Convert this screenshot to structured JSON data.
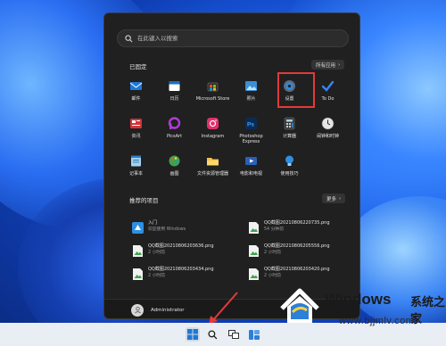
{
  "search": {
    "placeholder": "在此键入以搜索"
  },
  "pinned": {
    "title": "已固定",
    "all_apps": "所有应用",
    "apps": [
      {
        "label": "邮件",
        "icon": "mail-icon",
        "color": "#1e78d7"
      },
      {
        "label": "日历",
        "icon": "calendar-icon",
        "color": "#1d6fc4"
      },
      {
        "label": "Microsoft Store",
        "icon": "store-icon",
        "color": "#3b3b3b"
      },
      {
        "label": "照片",
        "icon": "photos-icon",
        "color": "#3a8fd8"
      },
      {
        "label": "设置",
        "icon": "gear-icon",
        "color": "#4a5a6e"
      },
      {
        "label": "To Do",
        "icon": "check-icon",
        "color": "#2f6fe0"
      },
      {
        "label": "资讯",
        "icon": "news-icon",
        "color": "#d13438"
      },
      {
        "label": "PicsArt",
        "icon": "picsart-icon",
        "color": "#b03ad8"
      },
      {
        "label": "Instagram",
        "icon": "instagram-icon",
        "color": "#e1306c"
      },
      {
        "label": "Photoshop Express",
        "icon": "photoshop-icon",
        "color": "#0b2b55"
      },
      {
        "label": "计算器",
        "icon": "calculator-icon",
        "color": "#2b2b2b"
      },
      {
        "label": "闹钟和时钟",
        "icon": "clock-icon",
        "color": "#cfcfcf"
      },
      {
        "label": "记事本",
        "icon": "notepad-icon",
        "color": "#3a9ad9"
      },
      {
        "label": "画图",
        "icon": "paint-icon",
        "color": "#3a7bd5"
      },
      {
        "label": "文件资源管理器",
        "icon": "folder-icon",
        "color": "#f2c14e"
      },
      {
        "label": "电影和电视",
        "icon": "movies-icon",
        "color": "#2b5fb8"
      },
      {
        "label": "使用技巧",
        "icon": "tips-icon",
        "color": "#2f8fe0"
      }
    ]
  },
  "recommended": {
    "title": "推荐的项目",
    "more": "更多",
    "items": [
      {
        "name": "入门",
        "sub": "欢迎使用 Windows",
        "icon": "getstarted-icon"
      },
      {
        "name": "QQ截图20210806220735.png",
        "sub": "54 分钟前",
        "icon": "image-file-icon"
      },
      {
        "name": "QQ截图20210806203636.png",
        "sub": "2 小时前",
        "icon": "image-file-icon"
      },
      {
        "name": "QQ截图20210806205556.png",
        "sub": "2 小时前",
        "icon": "image-file-icon"
      },
      {
        "name": "QQ截图20210806203434.png",
        "sub": "2 小时前",
        "icon": "image-file-icon"
      },
      {
        "name": "QQ截图20210806203420.png",
        "sub": "2 小时前",
        "icon": "image-file-icon"
      }
    ]
  },
  "user": {
    "name": "Administrator"
  },
  "watermark": {
    "brand": "Windows",
    "brand_cn": "系统之家",
    "url": "www.bjjmlv.com"
  },
  "colors": {
    "menu_bg": "#202020",
    "highlight": "#e23a3a",
    "taskbar": "#e9eef4"
  }
}
